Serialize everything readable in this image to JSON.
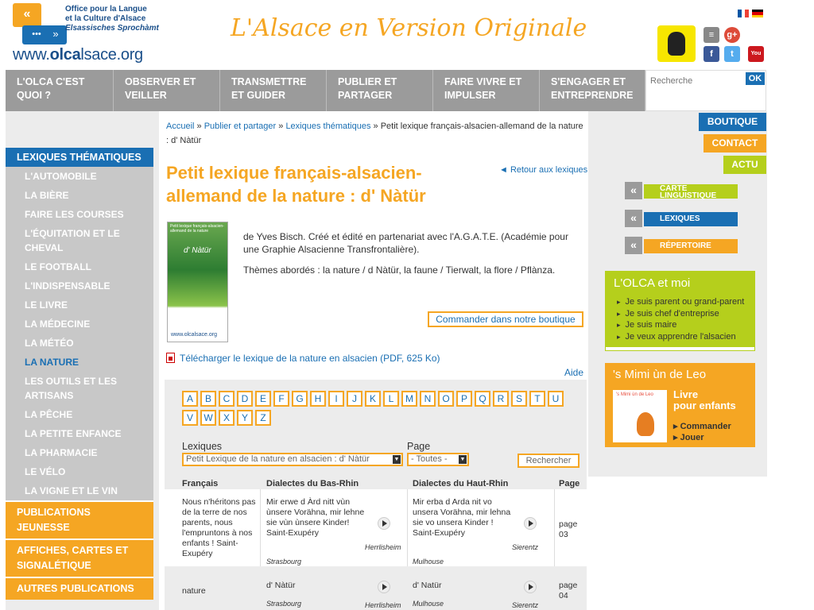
{
  "logo": {
    "line1": "Office pour la Langue",
    "line2": "et la Culture d'Alsace",
    "line3": "Elsassisches Sprochàmt",
    "url_prefix": "www.",
    "url_bold": "olca",
    "url_suffix": "lsace.org"
  },
  "site_title": "L'Alsace en Version Originale",
  "nav": [
    {
      "label": "L'OLCA C'EST QUOI ?"
    },
    {
      "label": "OBSERVER ET VEILLER"
    },
    {
      "label": "TRANSMETTRE ET GUIDER"
    },
    {
      "label": "PUBLIER ET PARTAGER"
    },
    {
      "label": "FAIRE VIVRE ET IMPULSER"
    },
    {
      "label": "S'ENGAGER ET ENTREPRENDRE"
    }
  ],
  "search": {
    "placeholder": "Recherche",
    "button": "OK"
  },
  "colors": {
    "orange": "#f5a623",
    "blue": "#1a6fb3",
    "green": "#b5cf1c",
    "grey": "#9b9b9b"
  },
  "sidebar": {
    "heading": "LEXIQUES THÉMATIQUES",
    "items": [
      "L'AUTOMOBILE",
      "LA BIÈRE",
      "FAIRE LES COURSES",
      "L'ÉQUITATION ET LE CHEVAL",
      "LE FOOTBALL",
      "L'INDISPENSABLE",
      "LE LIVRE",
      "LA MÉDECINE",
      "LA MÉTÉO",
      "LA NATURE",
      "LES OUTILS ET LES ARTISANS",
      "LA PÊCHE",
      "LA PETITE ENFANCE",
      "LA PHARMACIE",
      "LE VÉLO",
      "LA VIGNE ET LE VIN"
    ],
    "orange_items": [
      "PUBLICATIONS JEUNESSE",
      "AFFICHES, CARTES ET SIGNALÉTIQUE",
      "AUTRES PUBLICATIONS"
    ]
  },
  "breadcrumb": {
    "home": "Accueil",
    "sep": " » ",
    "level1": "Publier et partager",
    "level2": "Lexiques thématiques",
    "current": "Petit lexique français-alsacien-allemand de la nature : d' Nàtür"
  },
  "page_title": "Petit lexique français-alsacien-allemand de la nature : d' Nàtür",
  "back_link": "◄ Retour aux lexiques",
  "book": {
    "title_small": "Petit lexique français-alsacien-allemand de la nature",
    "name": "d' Nàtür",
    "logo": "www.olcalsace.org"
  },
  "description": {
    "p1": "de Yves Bisch. Créé et édité en partenariat avec l'A.G.A.T.E. (Académie pour une Graphie Alsacienne Transfrontalière).",
    "p2": "Thèmes abordés : la nature / d Nàtür,  la faune / Tierwalt, la flore / Pflànza."
  },
  "order_button": "Commander dans notre boutique",
  "pdf_link": "Télécharger le lexique de la nature en alsacien (PDF, 625 Ko)",
  "help": "Aide",
  "letters": [
    "A",
    "B",
    "C",
    "D",
    "E",
    "F",
    "G",
    "H",
    "I",
    "J",
    "K",
    "L",
    "M",
    "N",
    "O",
    "P",
    "Q",
    "R",
    "S",
    "T",
    "U",
    "V",
    "W",
    "X",
    "Y",
    "Z"
  ],
  "filters": {
    "lexique_label": "Lexiques",
    "lexique_value": "Petit Lexique de la nature en alsacien : d' Nàtür",
    "page_label": "Page",
    "page_value": "- Toutes -",
    "search_button": "Rechercher"
  },
  "table": {
    "headers": [
      "Français",
      "Dialectes du Bas-Rhin",
      "Dialectes du Haut-Rhin",
      "Page"
    ],
    "rows": [
      {
        "fr": "Nous n'héritons pas de la terre de nos parents, nous l'empruntons à nos enfants ! Saint-Exupéry",
        "bas": "Mir erwe d Àrd nitt vùn ùnsere Vorähna, mir lehne sie vùn ùnsere Kinder!\nSaint-Exupéry",
        "bas_loc1": "Herrlisheim",
        "bas_loc2": "Strasbourg",
        "haut": "Mir erba d Arda nit vo unsera Vorähna, mir lehna sie vo unsera Kinder !\nSaint-Exupéry",
        "haut_loc1": "Sierentz",
        "haut_loc2": "Mulhouse",
        "page": "page 03"
      },
      {
        "fr": "nature",
        "bas": "d' Nàtür",
        "bas_loc1": "Herrlisheim",
        "bas_loc2": "Strasbourg",
        "haut": "d' Natür",
        "haut_loc1": "Sierentz",
        "haut_loc2": "Mulhouse",
        "page": "page 04"
      }
    ]
  },
  "right": {
    "boutique": "BOUTIQUE",
    "contact": "CONTACT",
    "actu": "ACTU",
    "links": [
      "CARTE LINGUISTIQUE",
      "LEXIQUES",
      "RÉPERTOIRE"
    ],
    "olca_box": {
      "title": "L'OLCA et moi",
      "items": [
        "Je suis parent ou grand-parent",
        "Je suis chef d'entreprise",
        "Je suis maire",
        "Je veux apprendre l'alsacien"
      ]
    },
    "mimi_box": {
      "title": "'s Mimi ùn de Leo",
      "subtitle1": "Livre",
      "subtitle2": "pour enfants",
      "book_title": "'s Mimi ùn de Leo",
      "items": [
        "Commander",
        "Jouer"
      ]
    }
  }
}
